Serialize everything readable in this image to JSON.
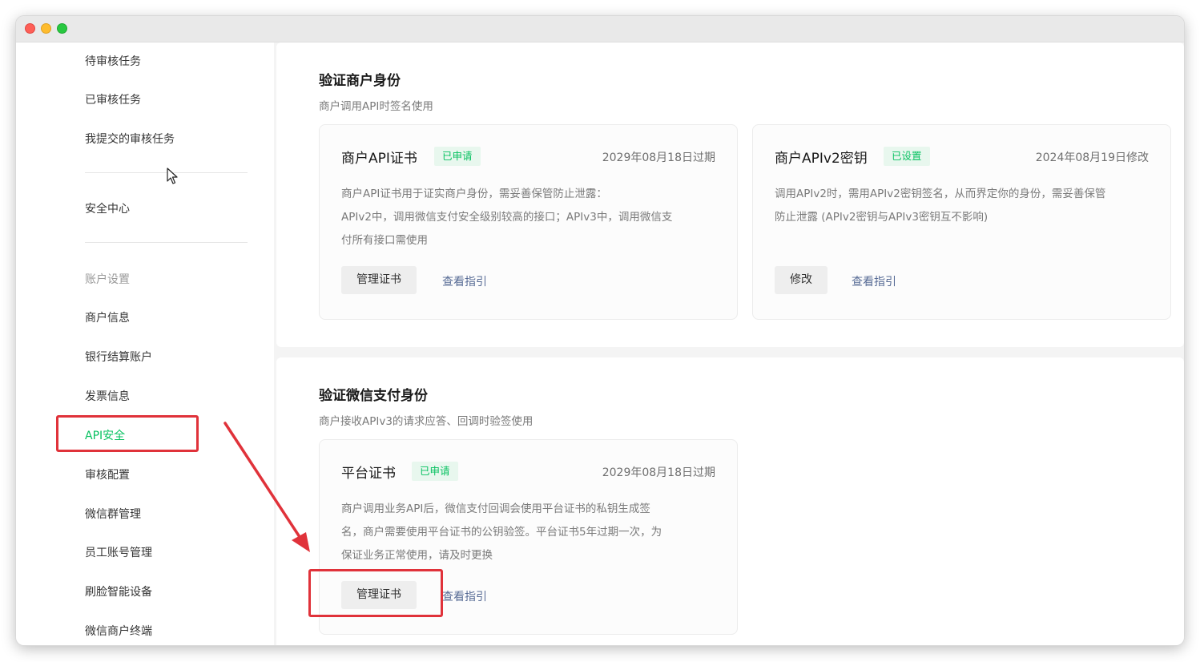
{
  "window": {
    "controls": [
      "close",
      "minimize",
      "zoom"
    ]
  },
  "sidebar": {
    "items": [
      {
        "label": "待审核任务"
      },
      {
        "label": "已审核任务"
      },
      {
        "label": "我提交的审核任务"
      },
      {
        "label": "安全中心"
      },
      {
        "label": "账户设置"
      },
      {
        "label": "商户信息"
      },
      {
        "label": "银行结算账户"
      },
      {
        "label": "发票信息"
      },
      {
        "label": "API安全"
      },
      {
        "label": "审核配置"
      },
      {
        "label": "微信群管理"
      },
      {
        "label": "员工账号管理"
      },
      {
        "label": "刷脸智能设备"
      },
      {
        "label": "微信商户终端"
      }
    ]
  },
  "section_merchant": {
    "title": "验证商户身份",
    "desc": "商户调用API时签名使用",
    "cards": [
      {
        "title": "商户API证书",
        "badge": "已申请",
        "date": "2029年08月18日过期",
        "desc_lines": [
          "商户API证书用于证实商户身份，需妥善保管防止泄露：",
          "APIv2中，调用微信支付安全级别较高的接口；APIv3中，调用微信支",
          "付所有接口需使用"
        ],
        "button": "管理证书",
        "link": "查看指引"
      },
      {
        "title": "商户APIv2密钥",
        "badge": "已设置",
        "date": "2024年08月19日修改",
        "desc_lines": [
          "调用APIv2时，需用APIv2密钥签名，从而界定你的身份，需妥善保管",
          "防止泄露 (APIv2密钥与APIv3密钥互不影响)"
        ],
        "button": "修改",
        "link": "查看指引"
      }
    ]
  },
  "section_wechat": {
    "title": "验证微信支付身份",
    "desc": "商户接收APIv3的请求应答、回调时验签使用",
    "cards": [
      {
        "title": "平台证书",
        "badge": "已申请",
        "date": "2029年08月18日过期",
        "desc_lines": [
          "商户调用业务API后，微信支付回调会使用平台证书的私钥生成签",
          "名，商户需要使用平台证书的公钥验签。平台证书5年过期一次，为",
          "保证业务正常使用，请及时更换"
        ],
        "button": "管理证书",
        "link": "查看指引"
      }
    ]
  },
  "colors": {
    "accent_green": "#07c160",
    "badge_bg": "#e8f7ee",
    "link_blue": "#576b95",
    "annotation_red": "#e0323a"
  }
}
